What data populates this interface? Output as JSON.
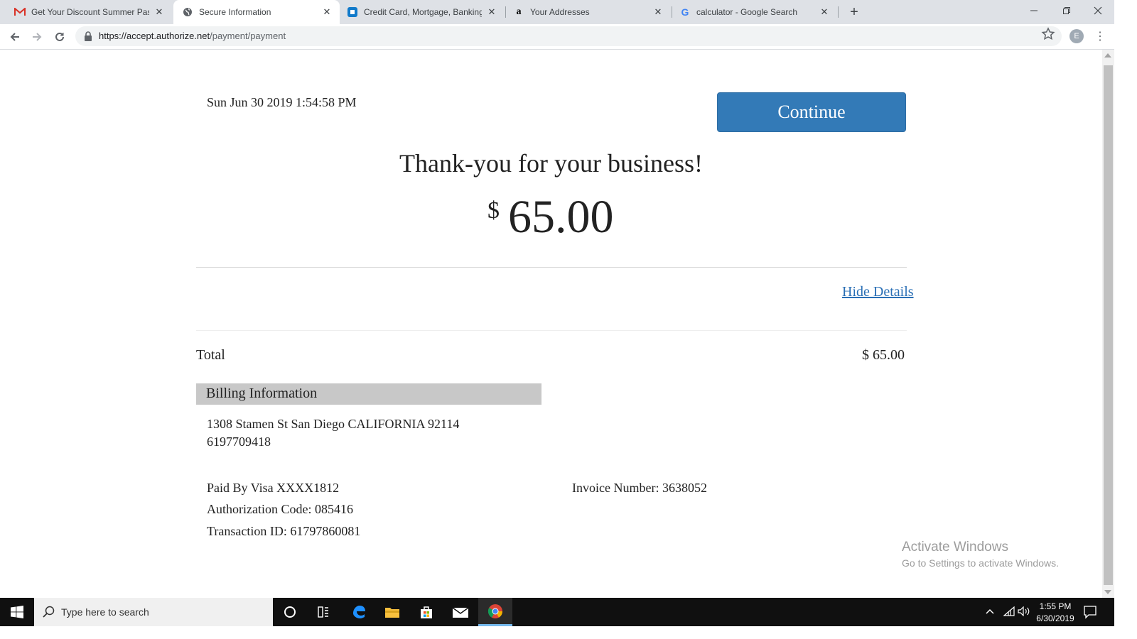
{
  "browser": {
    "tabs": [
      {
        "title": "Get Your Discount Summer Pass f",
        "favicon": "gmail-icon",
        "active": false
      },
      {
        "title": "Secure Information",
        "favicon": "globe-icon",
        "active": true
      },
      {
        "title": "Credit Card, Mortgage, Banking, A",
        "favicon": "chase-icon",
        "active": false
      },
      {
        "title": "Your Addresses",
        "favicon": "amazon-icon",
        "active": false
      },
      {
        "title": "calculator - Google Search",
        "favicon": "google-icon",
        "active": false
      }
    ],
    "url_host": "https://accept.authorize.net",
    "url_path": "/payment/payment",
    "profile_initial": "E"
  },
  "page": {
    "datetime": "Sun Jun 30 2019 1:54:58 PM",
    "continue_label": "Continue",
    "thanks": "Thank-you for your business!",
    "amount_currency": "$",
    "amount_value": "65.00",
    "hide_details": "Hide Details",
    "total_label": "Total",
    "total_value": "$ 65.00",
    "billing_header": "Billing Information",
    "billing_address": "1308 Stamen St San Diego CALIFORNIA 92114",
    "billing_phone": "6197709418",
    "paid_by": "Paid By Visa XXXX1812",
    "auth_code": "Authorization Code: 085416",
    "transaction_id": "Transaction ID: 61797860081",
    "invoice_number": "Invoice Number: 3638052"
  },
  "watermark": {
    "line1": "Activate Windows",
    "line2": "Go to Settings to activate Windows."
  },
  "taskbar": {
    "search_placeholder": "Type here to search",
    "time": "1:55 PM",
    "date": "6/30/2019"
  }
}
